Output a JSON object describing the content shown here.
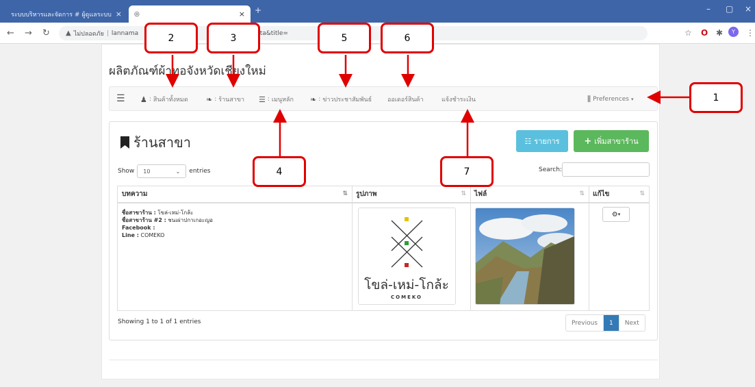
{
  "browser": {
    "tabs": [
      {
        "title": "ระบบบริหารและจัดการ # ผู้ดูแลระบบ",
        "close": "×"
      },
      {
        "title": "",
        "close": "×"
      }
    ],
    "new_tab": "+",
    "url_warning": "ไม่ปลอดภัย",
    "url_host": "lannama",
    "url_fragment_1": "s442_data&title=",
    "url_fragment_2": "0",
    "window_controls": [
      "–",
      "▢",
      "×"
    ]
  },
  "page": {
    "title": "ผลิตภัณฑ์ผ้าทอจังหวัดเชียงใหม่"
  },
  "navbar": {
    "items": [
      {
        "label": "สินค้าทั้งหมด",
        "prefix": ":"
      },
      {
        "label": "ร้านสาขา",
        "prefix": ":"
      },
      {
        "label": "เมนูหลัก",
        "prefix": ":"
      },
      {
        "label": "ข่าวประชาสัมพันธ์",
        "prefix": ":"
      },
      {
        "label": "ออเดอร์สินค้า",
        "prefix": ""
      },
      {
        "label": "แจ้งชำระเงิน",
        "prefix": ""
      }
    ],
    "preferences": "Preferences"
  },
  "panel": {
    "title": "ร้านสาขา",
    "btn_list": "รายการ",
    "btn_add": "เพิ่มสาขาร้าน",
    "show_label": "Show",
    "show_value": "10",
    "entries_label": "entries",
    "search_label": "Search:"
  },
  "table": {
    "headers": [
      "บทความ",
      "รูปภาพ",
      "ไฟล์",
      "แก้ไข"
    ],
    "row": {
      "name_label": "ชื่อสาขาร้าน :",
      "name_value": "โขล่-เหม่-โกล้ะ",
      "name2_label": "ชื่อสาขาร้าน #2 :",
      "name2_value": "ชนเผ่าปกาเกอะญอ",
      "facebook_label": "Facebook :",
      "line_label": "Line :",
      "line_value": "COMEKO",
      "logo_text": "โขล่-เหม่-โกล้ะ",
      "logo_sub": "COMEKO"
    }
  },
  "footer": {
    "info": "Showing 1 to 1 of 1 entries",
    "prev": "Previous",
    "page": "1",
    "next": "Next"
  },
  "callouts": [
    "1",
    "2",
    "3",
    "4",
    "5",
    "6",
    "7"
  ],
  "colors": {
    "annotation": "#e00000",
    "info_button": "#5bc0de",
    "success_button": "#5cb85c",
    "pager_active": "#337ab7"
  }
}
